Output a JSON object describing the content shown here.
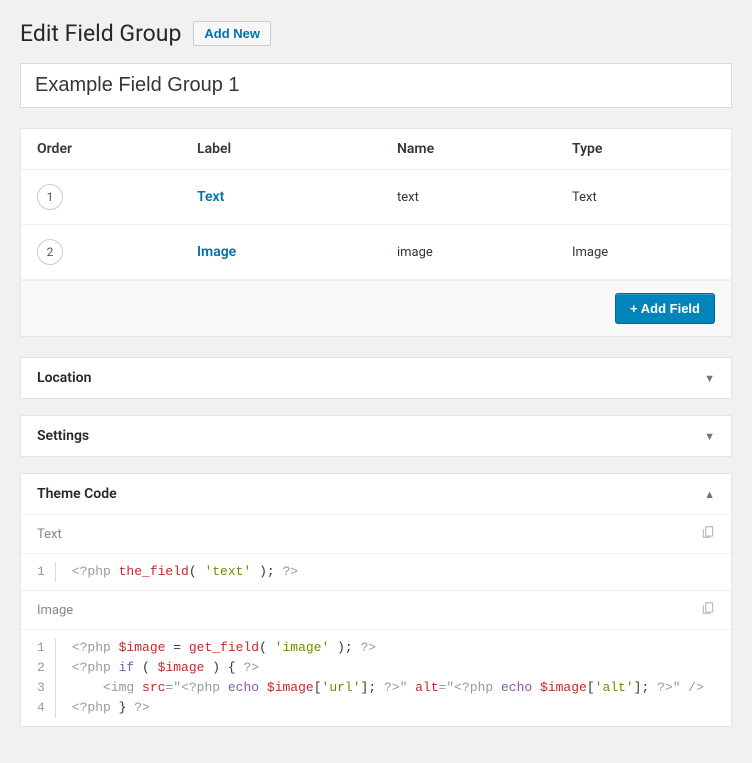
{
  "header": {
    "title": "Edit Field Group",
    "add_new_label": "Add New"
  },
  "group_title": "Example Field Group 1",
  "fields_table": {
    "headers": {
      "order": "Order",
      "label": "Label",
      "name": "Name",
      "type": "Type"
    },
    "rows": [
      {
        "order": "1",
        "label": "Text",
        "name": "text",
        "type": "Text"
      },
      {
        "order": "2",
        "label": "Image",
        "name": "image",
        "type": "Image"
      }
    ],
    "add_field_label": "+ Add Field"
  },
  "postboxes": {
    "location": {
      "title": "Location"
    },
    "settings": {
      "title": "Settings"
    },
    "theme_code": {
      "title": "Theme Code"
    }
  },
  "theme_code": {
    "sections": [
      {
        "label": "Text",
        "lines": [
          {
            "num": "1",
            "tokens": [
              {
                "t": "<?php ",
                "c": "tok-tag"
              },
              {
                "t": "the_field",
                "c": "tok-func"
              },
              {
                "t": "( ",
                "c": ""
              },
              {
                "t": "'text'",
                "c": "tok-str"
              },
              {
                "t": " ); ",
                "c": ""
              },
              {
                "t": "?>",
                "c": "tok-tag"
              }
            ]
          }
        ]
      },
      {
        "label": "Image",
        "lines": [
          {
            "num": "1",
            "tokens": [
              {
                "t": "<?php ",
                "c": "tok-tag"
              },
              {
                "t": "$image",
                "c": "tok-var"
              },
              {
                "t": " = ",
                "c": ""
              },
              {
                "t": "get_field",
                "c": "tok-func"
              },
              {
                "t": "( ",
                "c": ""
              },
              {
                "t": "'image'",
                "c": "tok-str"
              },
              {
                "t": " ); ",
                "c": ""
              },
              {
                "t": "?>",
                "c": "tok-tag"
              }
            ]
          },
          {
            "num": "2",
            "tokens": [
              {
                "t": "<?php ",
                "c": "tok-tag"
              },
              {
                "t": "if",
                "c": "tok-kw"
              },
              {
                "t": " ( ",
                "c": ""
              },
              {
                "t": "$image",
                "c": "tok-var"
              },
              {
                "t": " ) { ",
                "c": ""
              },
              {
                "t": "?>",
                "c": "tok-tag"
              }
            ]
          },
          {
            "num": "3",
            "tokens": [
              {
                "t": "    ",
                "c": ""
              },
              {
                "t": "<img ",
                "c": "tok-tag"
              },
              {
                "t": "src",
                "c": "tok-attr"
              },
              {
                "t": "=\"",
                "c": "tok-tag"
              },
              {
                "t": "<?php ",
                "c": "tok-tag"
              },
              {
                "t": "echo",
                "c": "tok-kw"
              },
              {
                "t": " ",
                "c": ""
              },
              {
                "t": "$image",
                "c": "tok-var"
              },
              {
                "t": "[",
                "c": ""
              },
              {
                "t": "'url'",
                "c": "tok-str"
              },
              {
                "t": "]; ",
                "c": ""
              },
              {
                "t": "?>",
                "c": "tok-tag"
              },
              {
                "t": "\" ",
                "c": "tok-tag"
              },
              {
                "t": "alt",
                "c": "tok-attr"
              },
              {
                "t": "=\"",
                "c": "tok-tag"
              },
              {
                "t": "<?php ",
                "c": "tok-tag"
              },
              {
                "t": "echo",
                "c": "tok-kw"
              },
              {
                "t": " ",
                "c": ""
              },
              {
                "t": "$image",
                "c": "tok-var"
              },
              {
                "t": "[",
                "c": ""
              },
              {
                "t": "'alt'",
                "c": "tok-str"
              },
              {
                "t": "]; ",
                "c": ""
              },
              {
                "t": "?>",
                "c": "tok-tag"
              },
              {
                "t": "\" />",
                "c": "tok-tag"
              }
            ]
          },
          {
            "num": "4",
            "tokens": [
              {
                "t": "<?php ",
                "c": "tok-tag"
              },
              {
                "t": "} ",
                "c": ""
              },
              {
                "t": "?>",
                "c": "tok-tag"
              }
            ]
          }
        ]
      }
    ]
  }
}
